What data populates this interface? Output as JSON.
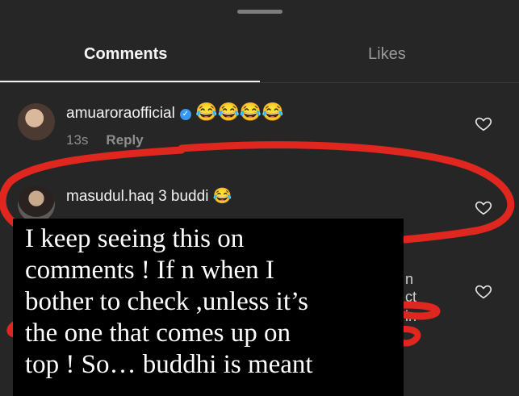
{
  "tabs": {
    "comments": "Comments",
    "likes": "Likes"
  },
  "comments": [
    {
      "username": "amuaroraofficial",
      "verified": true,
      "text": "😂😂😂😂",
      "time": "13s",
      "reply": "Reply"
    },
    {
      "username": "masudul.haq",
      "text": "3 buddi 😂"
    }
  ],
  "overlay_note": "I keep seeing this on\ncomments ! If n when I\nbother to check ,unless it’s\nthe one that comes up on\ntop ! So… buddhi is meant",
  "side_fragments": [
    "n",
    "ct",
    "in"
  ],
  "colors": {
    "annotation": "#e0271f",
    "verified": "#3897f0"
  },
  "icons": [
    "heart-icon",
    "verified-badge-icon"
  ]
}
